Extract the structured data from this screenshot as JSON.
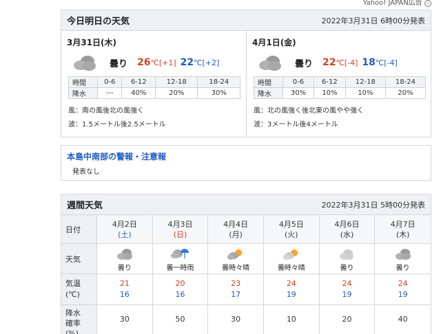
{
  "ad": {
    "label": "Yahoo! JAPAN広告",
    "info_icon": "info-icon"
  },
  "today": {
    "title": "今日明日の天気",
    "issued": "2022年3月31日 6時00分発表",
    "days": [
      {
        "date": "3月31日(木)",
        "weather": "曇り",
        "icon": "cloudy-icon",
        "high": "26",
        "high_unit": "℃",
        "high_diff": "[+1]",
        "low": "22",
        "low_unit": "℃",
        "low_diff": "[+2]",
        "rain_header": [
          "時間",
          "0-6",
          "6-12",
          "12-18",
          "18-24"
        ],
        "rain_values": [
          "降水",
          "---",
          "40%",
          "20%",
          "30%"
        ],
        "wind": "風：南の風後北の風強く",
        "wave": "波：1.5メートル後2.5メートル"
      },
      {
        "date": "4月1日(金)",
        "weather": "曇り",
        "icon": "cloudy-icon",
        "high": "22",
        "high_unit": "℃",
        "high_diff": "[-4]",
        "low": "18",
        "low_unit": "℃",
        "low_diff": "[-4]",
        "rain_header": [
          "時間",
          "0-6",
          "6-12",
          "12-18",
          "18-24"
        ],
        "rain_values": [
          "降水",
          "30%",
          "10%",
          "10%",
          "20%"
        ],
        "wind": "風：北の風強く後北東の風やや強く",
        "wave": "波：3メートル後4メートル"
      }
    ]
  },
  "warning": {
    "title": "本島中南部の警報・注意報",
    "text": "発表なし"
  },
  "week": {
    "title": "週間天気",
    "issued": "2022年3月31日 5時00分発表",
    "row_labels": {
      "date": "日付",
      "weather": "天気",
      "temp": "気温\n(℃)",
      "rain": "降水\n確率\n(%)"
    },
    "days": [
      {
        "date": "4月2日",
        "dow": "(土)",
        "weather": "曇り",
        "icon": "cloudy-icon",
        "high": "21",
        "low": "16",
        "rain": "30"
      },
      {
        "date": "4月3日",
        "dow": "(日)",
        "weather": "曇一時雨",
        "icon": "cloud-umbrella-icon",
        "high": "20",
        "low": "16",
        "rain": "50"
      },
      {
        "date": "4月4日",
        "dow": "(月)",
        "weather": "曇時々晴",
        "icon": "cloud-sun-icon",
        "high": "23",
        "low": "17",
        "rain": "30"
      },
      {
        "date": "4月5日",
        "dow": "(火)",
        "weather": "曇時々晴",
        "icon": "cloud-sun-icon",
        "high": "24",
        "low": "19",
        "rain": "10"
      },
      {
        "date": "4月6日",
        "dow": "(水)",
        "weather": "曇り",
        "icon": "cloudy-icon",
        "high": "24",
        "low": "19",
        "rain": "20"
      },
      {
        "date": "4月7日",
        "dow": "(木)",
        "weather": "曇り",
        "icon": "cloudy-icon",
        "high": "24",
        "low": "19",
        "rain": "40"
      }
    ]
  },
  "colors": {
    "hot": "#d9401c",
    "cold": "#1f5bc6",
    "header_bg": "#eef0f4",
    "border": "#d6d6d6"
  }
}
